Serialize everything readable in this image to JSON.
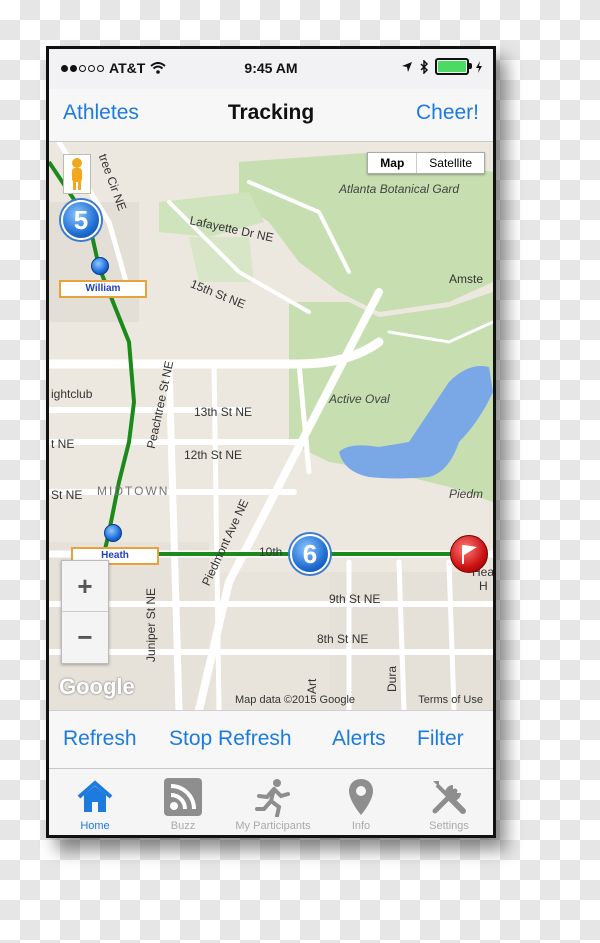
{
  "status_bar": {
    "carrier": "AT&T",
    "time": "9:45 AM"
  },
  "nav": {
    "left_button": "Athletes",
    "title": "Tracking",
    "right_button": "Cheer!"
  },
  "map": {
    "type_control": {
      "map": "Map",
      "satellite": "Satellite"
    },
    "labels": {
      "street_1": "tree Cir NE",
      "lafayette": "Lafayette Dr NE",
      "15th": "15th St NE",
      "botanical": "Atlanta Botanical Gard",
      "amste": "Amste",
      "nightclub": "ightclub",
      "active_oval": "Active Oval",
      "13th": "13th St NE",
      "12th": "12th St NE",
      "ne1": "t NE",
      "ne2": "St NE",
      "midtown": "MIDTOWN",
      "piedmont_ave": "Piedmont Ave NE",
      "peachtree": "Peachtree St NE",
      "10th": "10th",
      "piedm": "Piedm",
      "hea": "Hea",
      "h": "H",
      "9th": "9th St NE",
      "8th": "8th St NE",
      "juniper": "Juniper St NE",
      "durant": "Dura",
      "art": "Art"
    },
    "athletes": {
      "william": "William",
      "heath": "Heath"
    },
    "badges": {
      "five": "5",
      "six": "6"
    },
    "zoom_in": "+",
    "zoom_out": "−",
    "google_logo": "Google",
    "map_data": "Map data ©2015 Google",
    "terms": "Terms of Use"
  },
  "actions": {
    "refresh": "Refresh",
    "stop_refresh": "Stop Refresh",
    "alerts": "Alerts",
    "filter": "Filter"
  },
  "tabs": [
    {
      "label": "Home",
      "icon": "home-icon",
      "active": true
    },
    {
      "label": "Buzz",
      "icon": "rss-icon",
      "active": false
    },
    {
      "label": "My Participants",
      "icon": "runner-icon",
      "active": false
    },
    {
      "label": "Info",
      "icon": "location-pin-icon",
      "active": false
    },
    {
      "label": "Settings",
      "icon": "tools-icon",
      "active": false
    }
  ],
  "colors": {
    "accent": "#1d7be0",
    "route": "#1b8a1b",
    "park": "#c7deb0",
    "water": "#7aa7e6"
  }
}
